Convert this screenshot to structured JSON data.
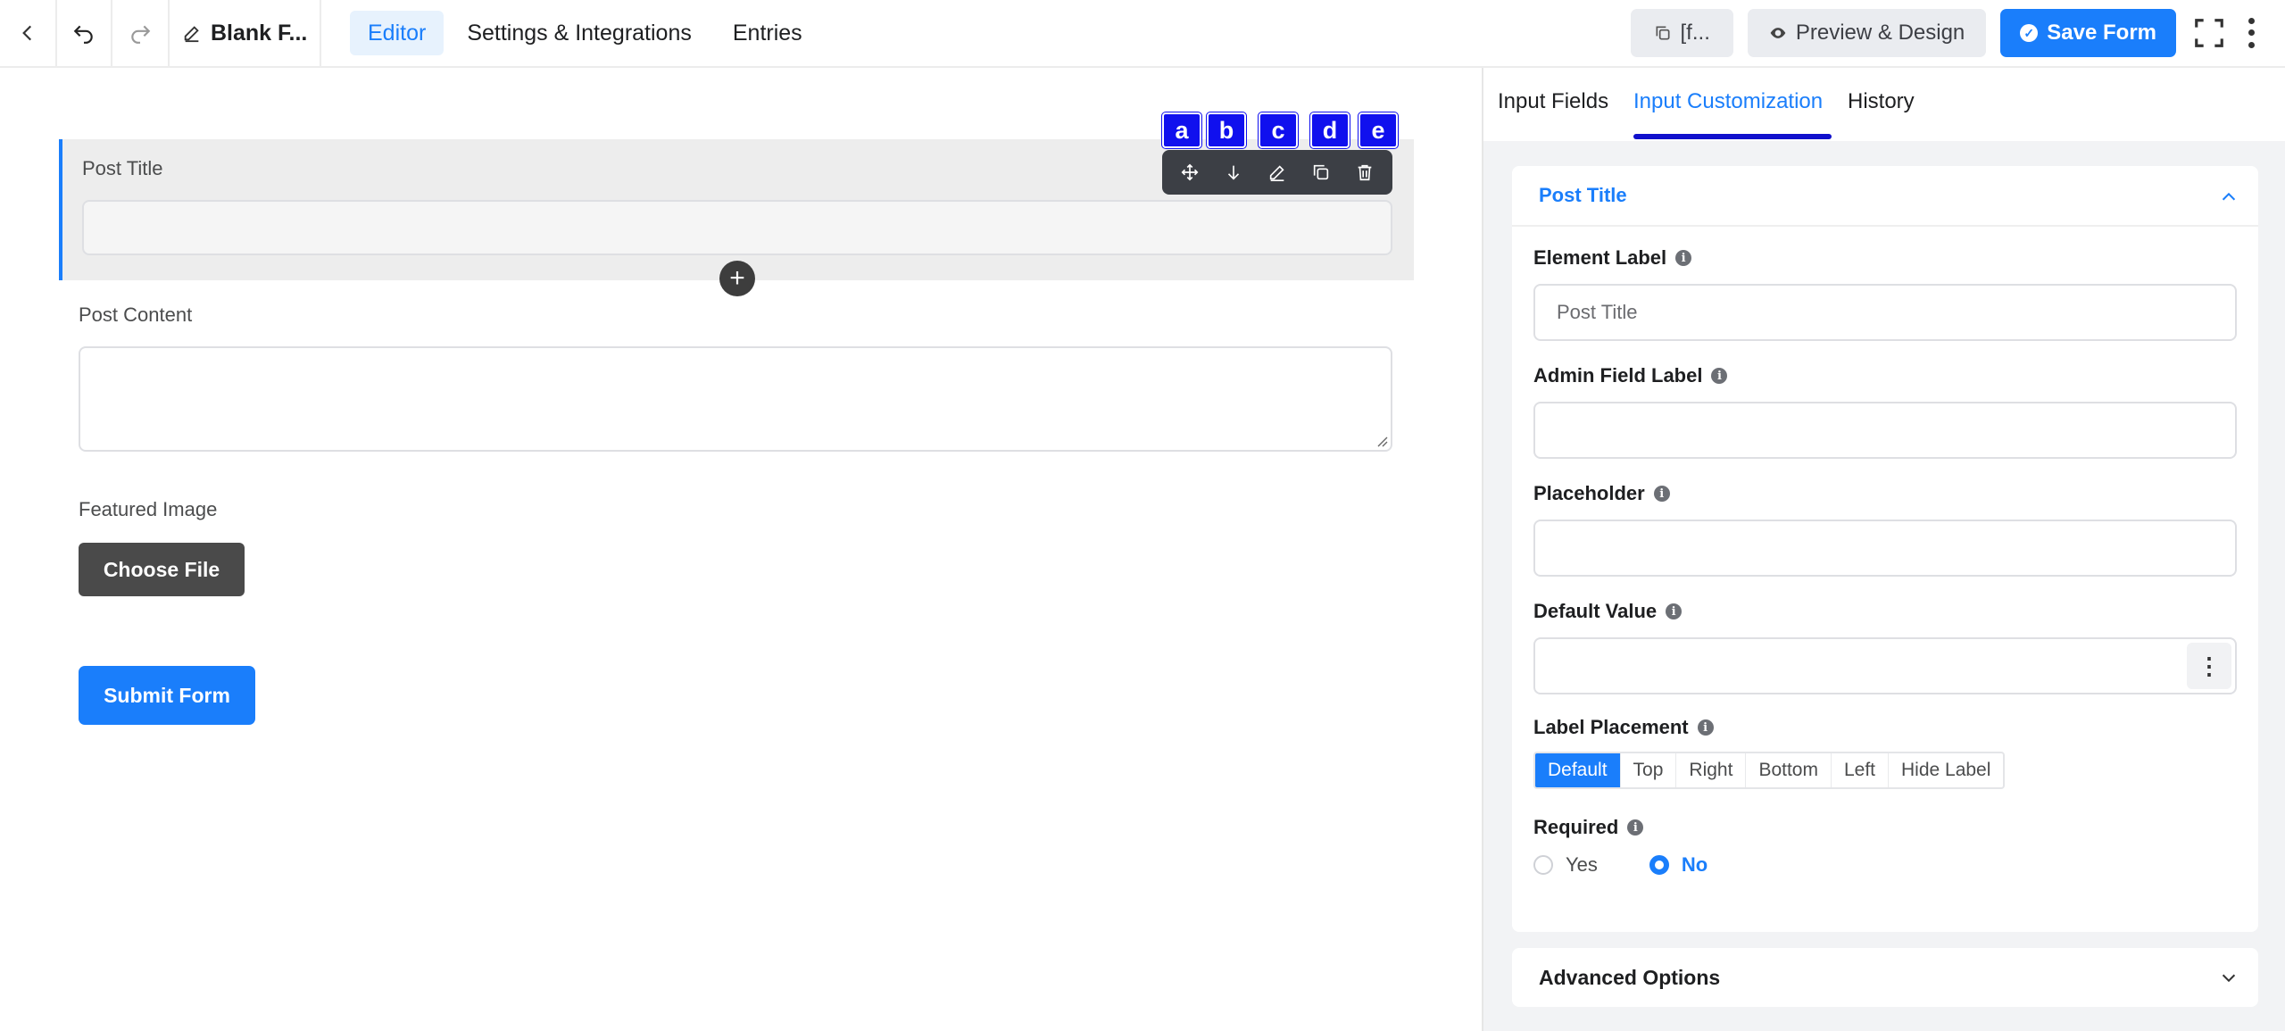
{
  "topbar": {
    "form_name": "Blank F...",
    "nav_tabs": [
      "Editor",
      "Settings & Integrations",
      "Entries"
    ],
    "shortcode_label": "[f...",
    "preview_label": "Preview & Design",
    "save_label": "Save Form"
  },
  "editor": {
    "fields": {
      "post_title_label": "Post Title",
      "post_content_label": "Post Content",
      "featured_image_label": "Featured Image"
    },
    "choose_file_label": "Choose File",
    "submit_label": "Submit Form",
    "badges": [
      "a",
      "b",
      "c",
      "d",
      "e"
    ]
  },
  "panel": {
    "tabs": [
      "Input Fields",
      "Input Customization",
      "History"
    ],
    "section_title": "Post Title",
    "element_label": "Element Label",
    "element_label_placeholder": "Post Title",
    "admin_field_label": "Admin Field Label",
    "placeholder_label": "Placeholder",
    "default_value_label": "Default Value",
    "label_placement_label": "Label Placement",
    "placement_options": [
      "Default",
      "Top",
      "Right",
      "Bottom",
      "Left",
      "Hide Label"
    ],
    "required_label": "Required",
    "required_options": [
      "Yes",
      "No"
    ],
    "advanced_options": "Advanced Options"
  },
  "colors": {
    "accent": "#1a7efb",
    "badge": "#1010ee"
  }
}
